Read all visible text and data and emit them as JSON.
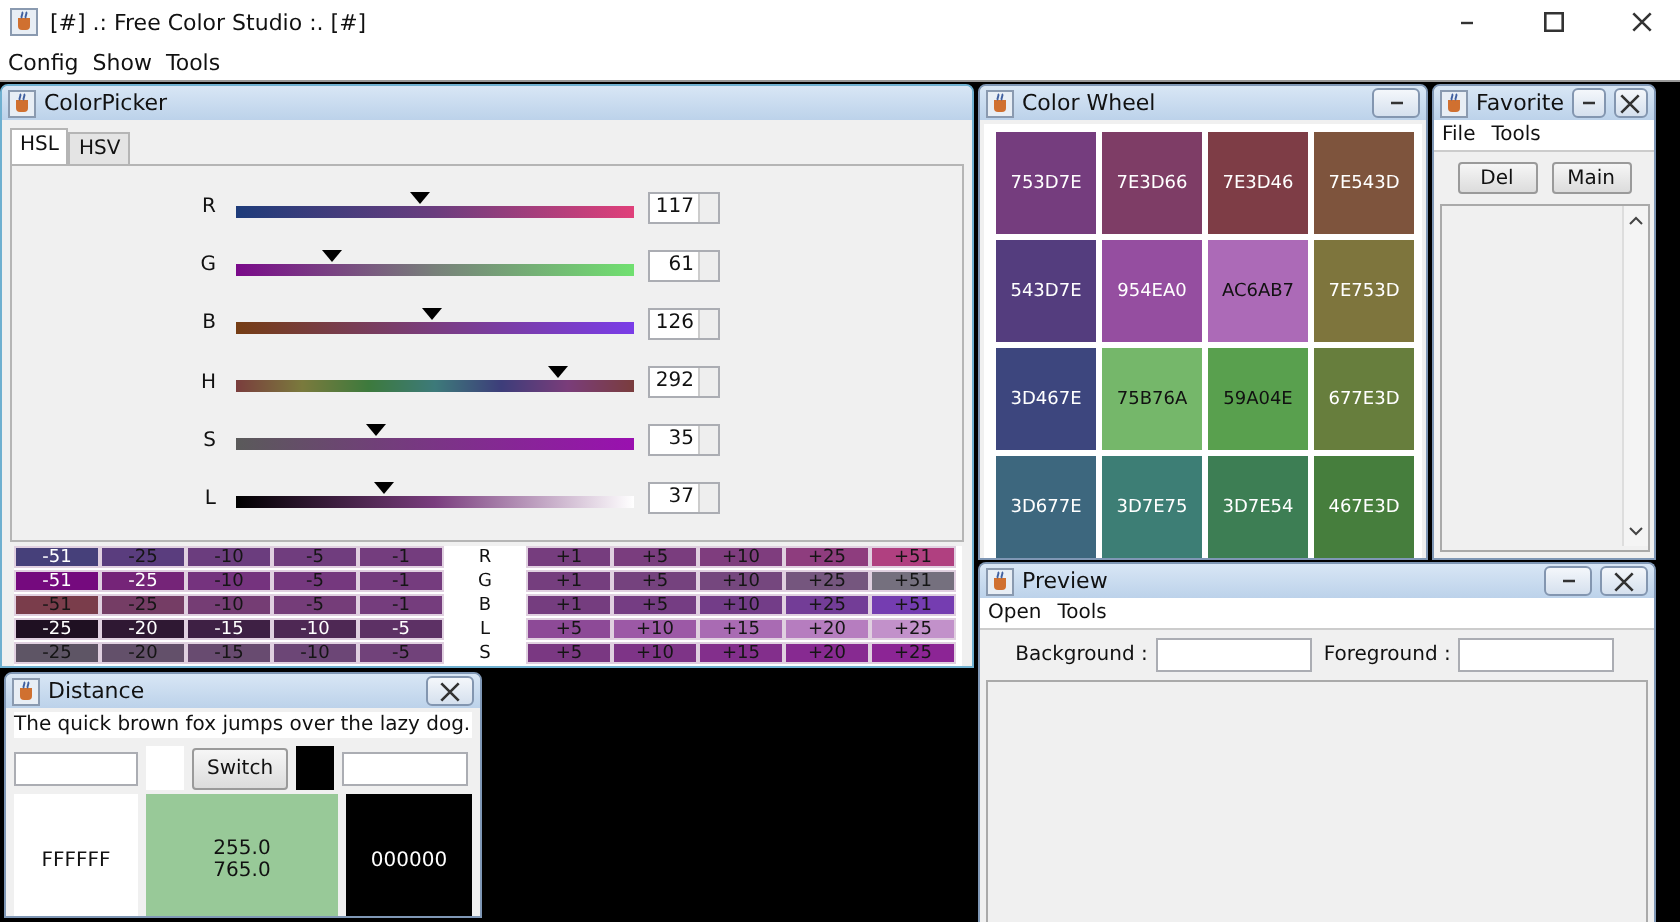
{
  "window": {
    "title": "[#] .: Free Color Studio :. [#]"
  },
  "menu": [
    "Config",
    "Show",
    "Tools"
  ],
  "color_picker": {
    "title": "ColorPicker",
    "tabs": [
      {
        "label": "HSL",
        "selected": true
      },
      {
        "label": "HSV",
        "selected": false
      }
    ],
    "sliders": [
      {
        "label": "R",
        "level": 0.46,
        "value": "117"
      },
      {
        "label": "G",
        "level": 0.24,
        "value": "61"
      },
      {
        "label": "B",
        "level": 0.49,
        "value": "126"
      },
      {
        "label": "H",
        "level": 0.81,
        "value": "292"
      },
      {
        "label": "S",
        "level": 0.35,
        "value": "35"
      },
      {
        "label": "L",
        "level": 0.37,
        "value": "37"
      }
    ],
    "adjust": [
      {
        "label": "R",
        "minus": [
          {
            "text": "-51",
            "color": "#46407a"
          },
          {
            "text": "-25",
            "color": "#5a3d7e"
          },
          {
            "text": "-10",
            "color": "#6b3d7e"
          },
          {
            "text": "-5",
            "color": "#703d7e"
          },
          {
            "text": "-1",
            "color": "#743d7e"
          }
        ],
        "plus": [
          {
            "text": "+1",
            "color": "#763d7e"
          },
          {
            "text": "+5",
            "color": "#7a3d7e"
          },
          {
            "text": "+10",
            "color": "#7f3d7e"
          },
          {
            "text": "+25",
            "color": "#8e3d7e"
          },
          {
            "text": "+51",
            "color": "#b04080"
          }
        ]
      },
      {
        "label": "G",
        "minus": [
          {
            "text": "-51",
            "color": "#750a7e"
          },
          {
            "text": "-25",
            "color": "#752478"
          },
          {
            "text": "-10",
            "color": "#75337e"
          },
          {
            "text": "-5",
            "color": "#75387e"
          },
          {
            "text": "-1",
            "color": "#753c7e"
          }
        ],
        "plus": [
          {
            "text": "+1",
            "color": "#753e7e"
          },
          {
            "text": "+5",
            "color": "#75427e"
          },
          {
            "text": "+10",
            "color": "#75477e"
          },
          {
            "text": "+25",
            "color": "#75567e"
          },
          {
            "text": "+51",
            "color": "#75707e"
          }
        ]
      },
      {
        "label": "B",
        "minus": [
          {
            "text": "-51",
            "color": "#7a3d4b"
          },
          {
            "text": "-25",
            "color": "#753d65"
          },
          {
            "text": "-10",
            "color": "#753d74"
          },
          {
            "text": "-5",
            "color": "#753d79"
          },
          {
            "text": "-1",
            "color": "#753d7d"
          }
        ],
        "plus": [
          {
            "text": "+1",
            "color": "#753d7f"
          },
          {
            "text": "+5",
            "color": "#753d83"
          },
          {
            "text": "+10",
            "color": "#733d88"
          },
          {
            "text": "+25",
            "color": "#733d97"
          },
          {
            "text": "+51",
            "color": "#753db1"
          }
        ]
      },
      {
        "label": "L",
        "minus": [
          {
            "text": "-25",
            "color": "#1f1022"
          },
          {
            "text": "-20",
            "color": "#2f1833"
          },
          {
            "text": "-15",
            "color": "#3e2044"
          },
          {
            "text": "-10",
            "color": "#4e2854"
          },
          {
            "text": "-5",
            "color": "#5d3165"
          }
        ],
        "plus": [
          {
            "text": "+5",
            "color": "#8d4a97"
          },
          {
            "text": "+10",
            "color": "#9c59a6"
          },
          {
            "text": "+15",
            "color": "#a96bb3"
          },
          {
            "text": "+20",
            "color": "#b67dbf"
          },
          {
            "text": "+25",
            "color": "#c291ca"
          }
        ]
      },
      {
        "label": "S",
        "minus": [
          {
            "text": "-25",
            "color": "#5e5565"
          },
          {
            "text": "-20",
            "color": "#63506a"
          },
          {
            "text": "-15",
            "color": "#684b70"
          },
          {
            "text": "-10",
            "color": "#6c4676"
          },
          {
            "text": "-5",
            "color": "#71427a"
          }
        ],
        "plus": [
          {
            "text": "+5",
            "color": "#7a3882"
          },
          {
            "text": "+10",
            "color": "#7e3487"
          },
          {
            "text": "+15",
            "color": "#832f8c"
          },
          {
            "text": "+20",
            "color": "#872a91"
          },
          {
            "text": "+25",
            "color": "#8c2595"
          }
        ]
      }
    ]
  },
  "distance": {
    "title": "Distance",
    "sentence": "The quick brown fox jumps over the lazy dog.",
    "swatches": [
      {
        "color": "#ffffff"
      },
      {
        "color": "#000000"
      }
    ],
    "button": "Switch",
    "panels": [
      {
        "lines": [
          "FFFFFF"
        ],
        "color": "#ffffff"
      },
      {
        "lines": [
          "255.0",
          "765.0"
        ],
        "color": "#98c998"
      },
      {
        "lines": [
          "000000"
        ],
        "color": "#000000"
      }
    ]
  },
  "color_wheel": {
    "title": "Color Wheel",
    "cells": [
      {
        "text": "753D7E",
        "color": "#753d7e"
      },
      {
        "text": "7E3D66",
        "color": "#7e3d66"
      },
      {
        "text": "7E3D46",
        "color": "#7e3d46"
      },
      {
        "text": "7E543D",
        "color": "#7e543d"
      },
      {
        "text": "543D7E",
        "color": "#543d7e"
      },
      {
        "text": "954EA0",
        "color": "#954ea0"
      },
      {
        "text": "AC6AB7",
        "color": "#ac6ab7"
      },
      {
        "text": "7E753D",
        "color": "#7e753d"
      },
      {
        "text": "3D467E",
        "color": "#3d467e"
      },
      {
        "text": "75B76A",
        "color": "#75b76a"
      },
      {
        "text": "59A04E",
        "color": "#59a04e"
      },
      {
        "text": "677E3D",
        "color": "#677e3d"
      },
      {
        "text": "3D677E",
        "color": "#3d677e"
      },
      {
        "text": "3D7E75",
        "color": "#3d7e75"
      },
      {
        "text": "3D7E54",
        "color": "#3d7e54"
      },
      {
        "text": "467E3D",
        "color": "#467e3d"
      }
    ]
  },
  "favorite": {
    "title": "Favorite",
    "menu": [
      "File",
      "Tools"
    ],
    "buttons": [
      "Del",
      "Main"
    ]
  },
  "preview": {
    "title": "Preview",
    "menu": [
      "Open",
      "Tools"
    ],
    "fields": [
      {
        "label": "Background :"
      },
      {
        "label": "Foreground :"
      }
    ]
  }
}
